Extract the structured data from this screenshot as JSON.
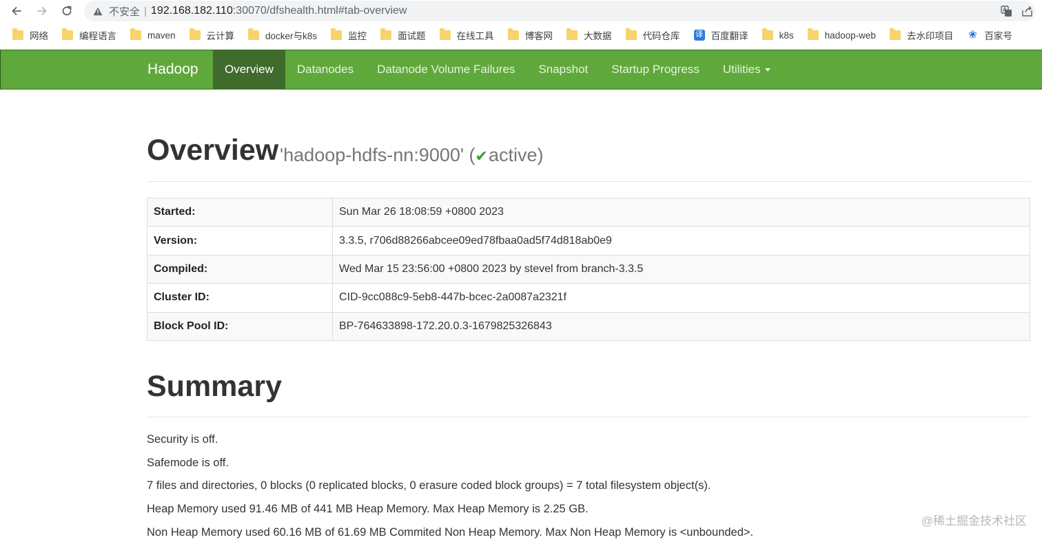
{
  "browser": {
    "insecure_label": "不安全",
    "separator": "|",
    "url_host": "192.168.182.110",
    "url_rest": ":30070/dfshealth.html#tab-overview"
  },
  "bookmarks": [
    {
      "label": "网络",
      "icon": "folder"
    },
    {
      "label": "编程语言",
      "icon": "folder"
    },
    {
      "label": "maven",
      "icon": "folder"
    },
    {
      "label": "云计算",
      "icon": "folder"
    },
    {
      "label": "docker与k8s",
      "icon": "folder"
    },
    {
      "label": "监控",
      "icon": "folder"
    },
    {
      "label": "面试题",
      "icon": "folder"
    },
    {
      "label": "在线工具",
      "icon": "folder"
    },
    {
      "label": "博客网",
      "icon": "folder"
    },
    {
      "label": "大数据",
      "icon": "folder"
    },
    {
      "label": "代码仓库",
      "icon": "folder"
    },
    {
      "label": "百度翻译",
      "icon": "translate",
      "glyph": "译"
    },
    {
      "label": "k8s",
      "icon": "folder"
    },
    {
      "label": "hadoop-web",
      "icon": "folder"
    },
    {
      "label": "去水印项目",
      "icon": "folder"
    },
    {
      "label": "百家号",
      "icon": "paw",
      "glyph": "❀"
    }
  ],
  "navbar": {
    "brand": "Hadoop",
    "items": [
      {
        "label": "Overview",
        "active": true
      },
      {
        "label": "Datanodes",
        "active": false
      },
      {
        "label": "Datanode Volume Failures",
        "active": false
      },
      {
        "label": "Snapshot",
        "active": false
      },
      {
        "label": "Startup Progress",
        "active": false
      },
      {
        "label": "Utilities",
        "active": false,
        "dropdown": true
      }
    ]
  },
  "overview": {
    "title": "Overview",
    "namenode": "'hadoop-hdfs-nn:9000' (",
    "check_glyph": "✔",
    "state": "active)",
    "rows": [
      {
        "key": "Started:",
        "value": "Sun Mar 26 18:08:59 +0800 2023"
      },
      {
        "key": "Version:",
        "value": "3.3.5, r706d88266abcee09ed78fbaa0ad5f74d818ab0e9"
      },
      {
        "key": "Compiled:",
        "value": "Wed Mar 15 23:56:00 +0800 2023 by stevel from branch-3.3.5"
      },
      {
        "key": "Cluster ID:",
        "value": "CID-9cc088c9-5eb8-447b-bcec-2a0087a2321f"
      },
      {
        "key": "Block Pool ID:",
        "value": "BP-764633898-172.20.0.3-1679825326843"
      }
    ]
  },
  "summary": {
    "title": "Summary",
    "lines": [
      "Security is off.",
      "Safemode is off.",
      "7 files and directories, 0 blocks (0 replicated blocks, 0 erasure coded block groups) = 7 total filesystem object(s).",
      "Heap Memory used 91.46 MB of 441 MB Heap Memory. Max Heap Memory is 2.25 GB.",
      "Non Heap Memory used 60.16 MB of 61.69 MB Commited Non Heap Memory. Max Non Heap Memory is <unbounded>."
    ]
  },
  "watermark": "@稀土掘金技术社区",
  "colors": {
    "navbar_bg": "#5fa83b",
    "navbar_active": "#3f6b2c",
    "check": "#3c9a32"
  }
}
